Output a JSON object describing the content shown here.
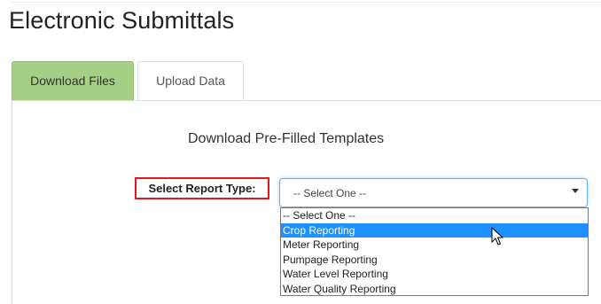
{
  "page": {
    "title": "Electronic Submittals"
  },
  "tabs": [
    {
      "label": "Download Files",
      "active": true
    },
    {
      "label": "Upload Data",
      "active": false
    }
  ],
  "section": {
    "heading": "Download Pre-Filled Templates"
  },
  "report_type": {
    "label": "Select Report Type:",
    "selected": "-- Select One --",
    "options": [
      "-- Select One --",
      "Crop Reporting",
      "Meter Reporting",
      "Pumpage Reporting",
      "Water Level Reporting",
      "Water Quality Reporting"
    ],
    "highlighted_option": "Crop Reporting"
  },
  "colors": {
    "active_tab": "#a5cf84",
    "highlight": "#1e90ff",
    "label_border": "#e01a1a",
    "focus_border": "#66afe9"
  },
  "icons": {
    "select_caret": "caret-down-icon",
    "cursor": "mouse-pointer-icon"
  }
}
